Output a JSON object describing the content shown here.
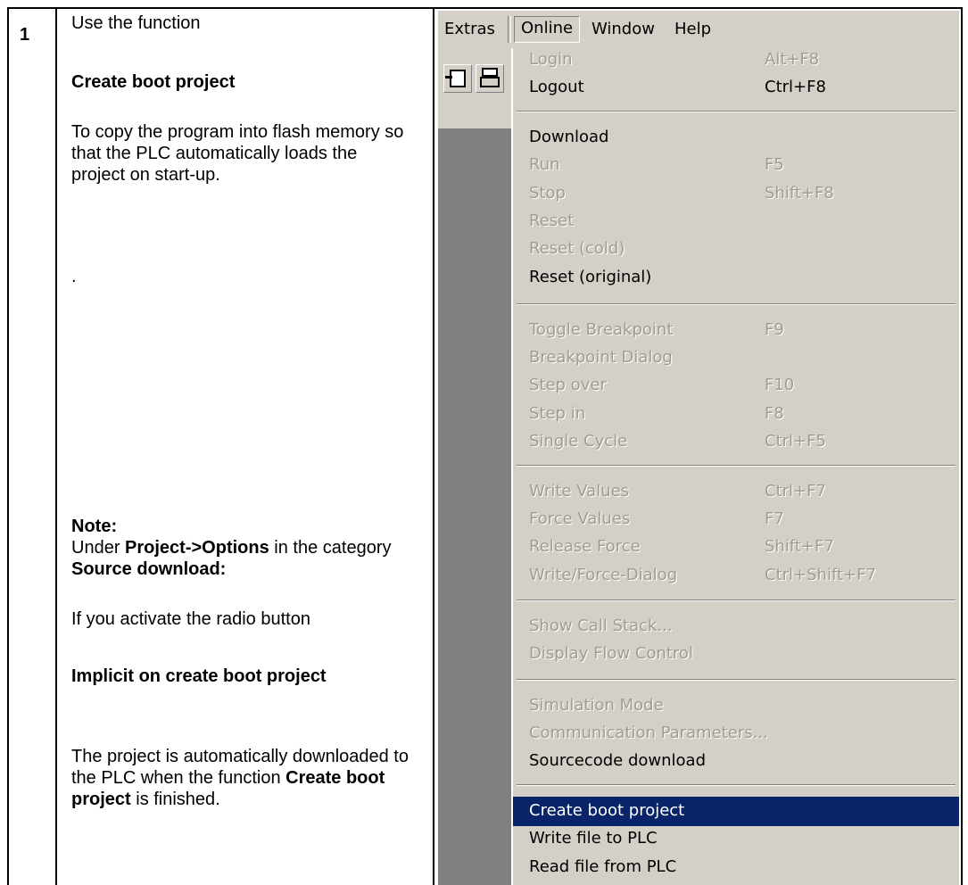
{
  "step": {
    "number": "1"
  },
  "instructions": {
    "p1": "Use the function",
    "p2_bold": "Create boot project",
    "p3": "To copy the program into flash memory so that the PLC automatically loads the project on start-up.",
    "p4": ".",
    "note_label": "Note:",
    "p5_pre": "Under ",
    "p5_bold1": "Project->Options",
    "p5_mid": " in the category ",
    "p5_bold2": "Source download:",
    "p6": "If you activate the radio button",
    "p7_bold": "Implicit on create boot project",
    "p8_pre": "The project is automatically downloaded to the PLC when the function ",
    "p8_bold": "Create boot project",
    "p8_post": " is finished."
  },
  "menubar": {
    "extras": "Extras",
    "online": "Online",
    "window": "Window",
    "help": "Help"
  },
  "menu": {
    "items": [
      {
        "label": "Login",
        "shortcut": "Alt+F8",
        "enabled": false
      },
      {
        "label": "Logout",
        "shortcut": "Ctrl+F8",
        "enabled": true
      },
      {
        "label": "Download",
        "shortcut": "",
        "enabled": true
      },
      {
        "label": "Run",
        "shortcut": "F5",
        "enabled": false
      },
      {
        "label": "Stop",
        "shortcut": "Shift+F8",
        "enabled": false
      },
      {
        "label": "Reset",
        "shortcut": "",
        "enabled": false
      },
      {
        "label": "Reset (cold)",
        "shortcut": "",
        "enabled": false
      },
      {
        "label": "Reset (original)",
        "shortcut": "",
        "enabled": true
      },
      {
        "label": "Toggle Breakpoint",
        "shortcut": "F9",
        "enabled": false
      },
      {
        "label": "Breakpoint Dialog",
        "shortcut": "",
        "enabled": false
      },
      {
        "label": "Step over",
        "shortcut": "F10",
        "enabled": false
      },
      {
        "label": "Step in",
        "shortcut": "F8",
        "enabled": false
      },
      {
        "label": "Single Cycle",
        "shortcut": "Ctrl+F5",
        "enabled": false
      },
      {
        "label": "Write Values",
        "shortcut": "Ctrl+F7",
        "enabled": false
      },
      {
        "label": "Force Values",
        "shortcut": "F7",
        "enabled": false
      },
      {
        "label": "Release Force",
        "shortcut": "Shift+F7",
        "enabled": false
      },
      {
        "label": "Write/Force-Dialog",
        "shortcut": "Ctrl+Shift+F7",
        "enabled": false
      },
      {
        "label": "Show Call Stack...",
        "shortcut": "",
        "enabled": false
      },
      {
        "label": "Display Flow Control",
        "shortcut": "",
        "enabled": false
      },
      {
        "label": "Simulation Mode",
        "shortcut": "",
        "enabled": false
      },
      {
        "label": "Communication Parameters...",
        "shortcut": "",
        "enabled": false
      },
      {
        "label": "Sourcecode download",
        "shortcut": "",
        "enabled": true
      },
      {
        "label": "Create boot project",
        "shortcut": "",
        "enabled": true,
        "selected": true
      },
      {
        "label": "Write file to PLC",
        "shortcut": "",
        "enabled": true
      },
      {
        "label": "Read file from PLC",
        "shortcut": "",
        "enabled": true
      }
    ]
  },
  "colors": {
    "menu_bg": "#d4d0c8",
    "highlight": "#0a246a",
    "disabled_text": "#a09c94",
    "workspace": "#808080"
  },
  "icons": [
    "load-arrow-icon",
    "printer-icon"
  ]
}
